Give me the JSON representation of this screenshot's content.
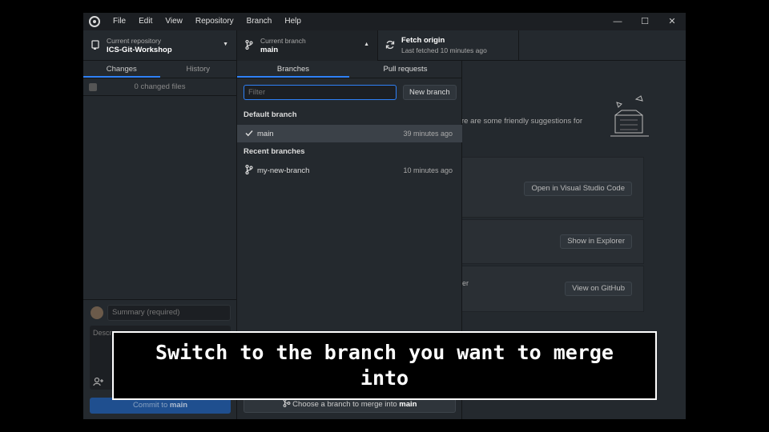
{
  "menu": [
    "File",
    "Edit",
    "View",
    "Repository",
    "Branch",
    "Help"
  ],
  "window_controls": {
    "minimize": "—",
    "maximize": "☐",
    "close": "✕"
  },
  "toolbar": {
    "repo_label": "Current repository",
    "repo_value": "ICS-Git-Workshop",
    "branch_label": "Current branch",
    "branch_value": "main",
    "fetch_title": "Fetch origin",
    "fetch_status": "Last fetched 10 minutes ago"
  },
  "sidebar": {
    "tabs": [
      "Changes",
      "History"
    ],
    "changed_files": "0 changed files",
    "summary_placeholder": "Summary (required)",
    "description_placeholder": "Descr",
    "commit_prefix": "Commit to ",
    "commit_branch": "main"
  },
  "main": {
    "friendly_text": "re are some friendly suggestions for",
    "card_partial": "er",
    "open_vscode": "Open in Visual Studio Code",
    "show_explorer": "Show in Explorer",
    "view_github": "View on GitHub"
  },
  "dropdown": {
    "tabs": [
      "Branches",
      "Pull requests"
    ],
    "filter_placeholder": "Filter",
    "new_branch": "New branch",
    "default_header": "Default branch",
    "recent_header": "Recent branches",
    "branches": [
      {
        "name": "main",
        "time": "39 minutes ago",
        "selected": true
      },
      {
        "name": "my-new-branch",
        "time": "10 minutes ago",
        "selected": false
      }
    ],
    "merge_prefix": "Choose a branch to merge into ",
    "merge_branch": "main"
  },
  "caption": "Switch to the branch you want to merge into"
}
